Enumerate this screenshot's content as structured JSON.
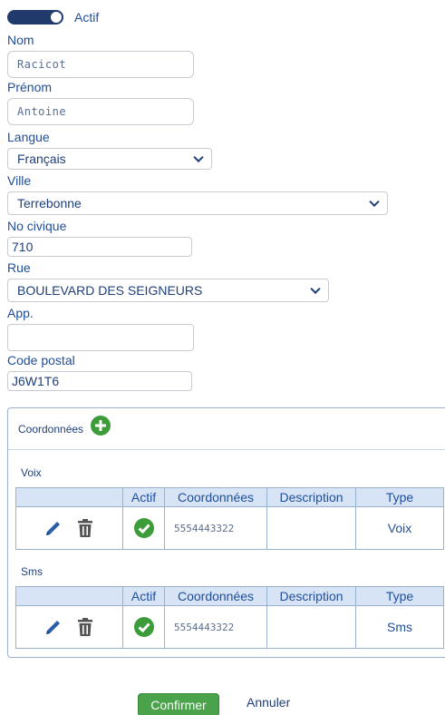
{
  "actif": {
    "label": "Actif",
    "on": true
  },
  "nom": {
    "label": "Nom",
    "value": "Racicot"
  },
  "prenom": {
    "label": "Prénom",
    "value": "Antoine"
  },
  "langue": {
    "label": "Langue",
    "value": "Français"
  },
  "ville": {
    "label": "Ville",
    "value": "Terrebonne"
  },
  "no_civique": {
    "label": "No civique",
    "value": "710"
  },
  "rue": {
    "label": "Rue",
    "value": "BOULEVARD DES SEIGNEURS"
  },
  "app": {
    "label": "App.",
    "value": ""
  },
  "code_postal": {
    "label": "Code postal",
    "value": "J6W1T6"
  },
  "coordonnees": {
    "title": "Coordonnées",
    "columns": [
      "",
      "Actif",
      "Coordonnées",
      "Description",
      "Type"
    ],
    "sections": [
      {
        "label": "Voix",
        "rows": [
          {
            "coord": "5554443322",
            "description": "",
            "type": "Voix"
          }
        ]
      },
      {
        "label": "Sms",
        "rows": [
          {
            "coord": "5554443322",
            "description": "",
            "type": "Sms"
          }
        ]
      }
    ]
  },
  "actions": {
    "confirm": "Confirmer",
    "cancel": "Annuler"
  },
  "colors": {
    "accent": "#1f3a6b",
    "green": "#3d9c3a",
    "header_bg": "#d6e4f6"
  },
  "icons": [
    "pencil-icon",
    "trash-icon",
    "check-icon",
    "plus-circle-icon",
    "chevron-down-icon"
  ]
}
